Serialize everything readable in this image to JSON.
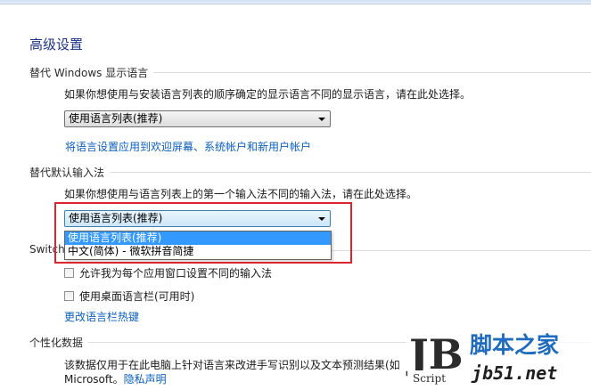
{
  "page": {
    "title": "高级设置"
  },
  "display_language": {
    "heading": "替代 Windows 显示语言",
    "description": "如果你想使用与安装语言列表的顺序确定的显示语言不同的显示语言，请在此处选择。",
    "select_value": "使用语言列表(推荐)",
    "apply_link": "将语言设置应用到欢迎屏幕、系统帐户和新用户帐户"
  },
  "input_method": {
    "heading": "替代默认输入法",
    "description": "如果你想使用与语言列表上的第一个输入法不同的输入法，请在此处选择。",
    "select_value": "使用语言列表(推荐)",
    "options": [
      "使用语言列表(推荐)",
      "中文(简体) - 微软拼音简捷"
    ],
    "selected_index": 0
  },
  "switching": {
    "heading_partial": "Switchi",
    "checkbox_per_app": "允许我为每个应用窗口设置不同的输入法",
    "checkbox_per_app_checked": false,
    "checkbox_langbar": "使用桌面语言栏(可用时)",
    "checkbox_langbar_checked": false,
    "hotkeys_link": "更改语言栏热键"
  },
  "personalization": {
    "heading": "个性化数据",
    "description": "该数据仅用于在此电脑上针对语言来改进手写识别以及文本预测结果(如",
    "line2_prefix": "Microsoft。",
    "privacy_link": "隐私声明"
  },
  "watermark": {
    "logo_letters": "JB",
    "script_label": "Script",
    "site_name": "脚本之家",
    "site_url": "jb51.net"
  },
  "colors": {
    "title": "#1e3287",
    "link": "#0b5fbf",
    "highlight": "#3399ff",
    "callout": "#d9262f",
    "watermark": "#1f6cbf"
  }
}
